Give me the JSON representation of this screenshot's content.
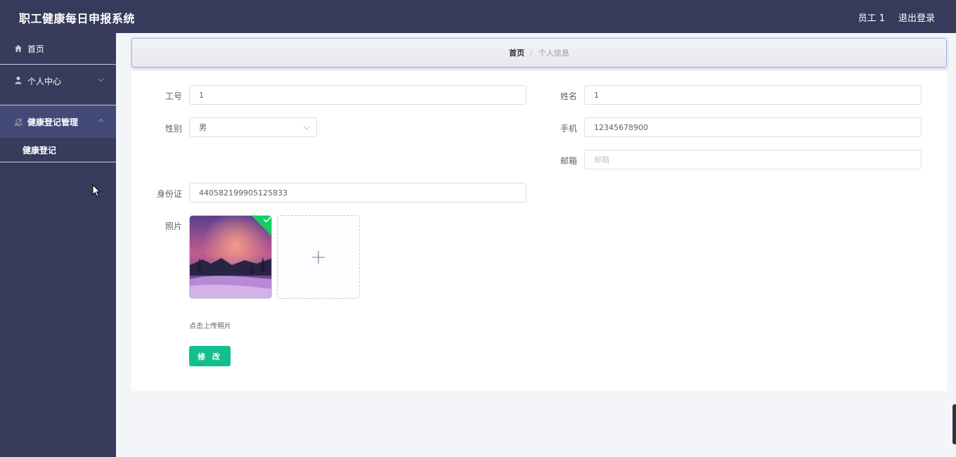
{
  "header": {
    "title": "职工健康每日申报系统",
    "user": "员工 1",
    "logout": "退出登录"
  },
  "sidebar": {
    "items": [
      {
        "label": "首页",
        "icon": "home-icon"
      },
      {
        "label": "个人中心",
        "icon": "user-icon"
      },
      {
        "label": "健康登记管理",
        "icon": "bell-icon"
      }
    ],
    "sub_item": "健康登记"
  },
  "breadcrumb": {
    "home": "首页",
    "separator": "/",
    "current": "个人信息"
  },
  "form": {
    "job_no": {
      "label": "工号",
      "value": "1"
    },
    "name": {
      "label": "姓名",
      "value": "1"
    },
    "gender": {
      "label": "性别",
      "value": "男"
    },
    "phone": {
      "label": "手机",
      "value": "12345678900"
    },
    "email": {
      "label": "邮箱",
      "placeholder": "邮箱"
    },
    "id_card": {
      "label": "身份证",
      "value": "440582199905125833"
    },
    "photo": {
      "label": "照片",
      "tip": "点击上传照片"
    },
    "submit": "修 改"
  },
  "colors": {
    "header_bg": "#363b5b",
    "sidebar_bg": "#373c5c",
    "active_bg": "#434a78",
    "button": "#13c08d",
    "success": "#13ce66"
  }
}
